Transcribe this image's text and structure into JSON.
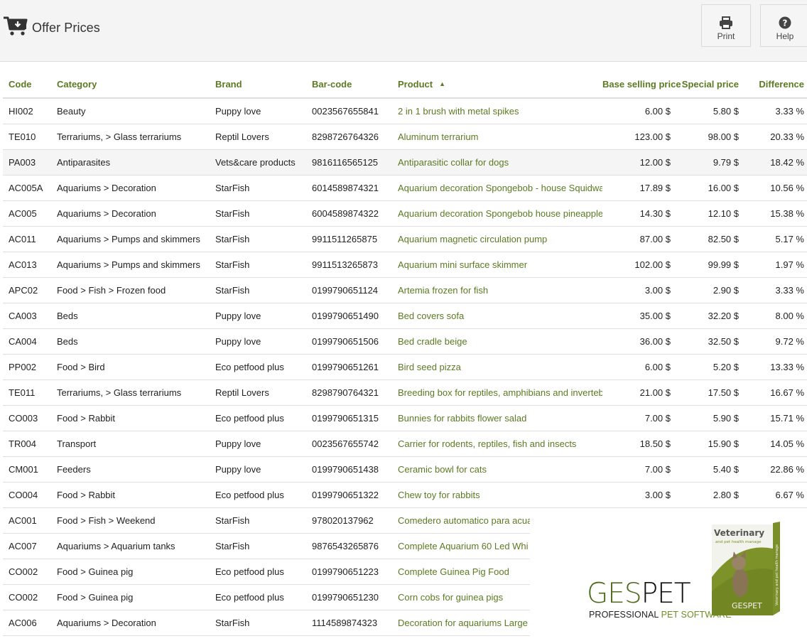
{
  "header": {
    "title": "Offer Prices",
    "icon": "cart-download-icon",
    "buttons": [
      {
        "label": "Print",
        "icon": "print-icon"
      },
      {
        "label": "Help",
        "icon": "help-circle-icon"
      }
    ]
  },
  "table": {
    "columns": [
      "Code",
      "Category",
      "Brand",
      "Bar-code",
      "Product",
      "Base selling price",
      "Special price",
      "Difference"
    ],
    "sort": {
      "column": "Product",
      "direction": "ascending",
      "icon": "sort-up-icon"
    },
    "rows": [
      {
        "code": "HI002",
        "category": "Beauty",
        "brand": "Puppy love",
        "barcode": "0023567655841",
        "product": "2 in 1 brush with metal spikes",
        "base": "6.00 $",
        "special": "5.80 $",
        "diff": "3.33 %"
      },
      {
        "code": "TE010",
        "category": "Terrariums, > Glass terrariums",
        "brand": "Reptil Lovers",
        "barcode": "8298726764326",
        "product": "Aluminum terrarium",
        "base": "123.00 $",
        "special": "98.00 $",
        "diff": "20.33 %"
      },
      {
        "code": "PA003",
        "category": "Antiparasites",
        "brand": "Vets&care products",
        "barcode": "9816116565125",
        "product": "Antiparasitic collar for dogs",
        "base": "12.00 $",
        "special": "9.79 $",
        "diff": "18.42 %",
        "highlighted": true
      },
      {
        "code": "AC005A",
        "category": "Aquariums > Decoration",
        "brand": "StarFish",
        "barcode": "6014589874321",
        "product": "Aquarium decoration Spongebob - house Squidward",
        "base": "17.89 $",
        "special": "16.00 $",
        "diff": "10.56 %"
      },
      {
        "code": "AC005",
        "category": "Aquariums > Decoration",
        "brand": "StarFish",
        "barcode": "6004589874322",
        "product": "Aquarium decoration Spongebob house pineapple",
        "base": "14.30 $",
        "special": "12.10 $",
        "diff": "15.38 %"
      },
      {
        "code": "AC011",
        "category": "Aquariums > Pumps and skimmers",
        "brand": "StarFish",
        "barcode": "9911511265875",
        "product": "Aquarium magnetic circulation pump",
        "base": "87.00 $",
        "special": "82.50 $",
        "diff": "5.17 %"
      },
      {
        "code": "AC013",
        "category": "Aquariums > Pumps and skimmers",
        "brand": "StarFish",
        "barcode": "9911513265873",
        "product": "Aquarium mini surface skimmer",
        "base": "102.00 $",
        "special": "99.99 $",
        "diff": "1.97 %"
      },
      {
        "code": "APC02",
        "category": "Food > Fish > Frozen food",
        "brand": "StarFish",
        "barcode": "0199790651124",
        "product": "Artemia frozen for fish",
        "base": "3.00 $",
        "special": "2.90 $",
        "diff": "3.33 %"
      },
      {
        "code": "CA003",
        "category": "Beds",
        "brand": "Puppy love",
        "barcode": "0199790651490",
        "product": "Bed covers sofa",
        "base": "35.00 $",
        "special": "32.20 $",
        "diff": "8.00 %"
      },
      {
        "code": "CA004",
        "category": "Beds",
        "brand": "Puppy love",
        "barcode": "0199790651506",
        "product": "Bed cradle beige",
        "base": "36.00 $",
        "special": "32.50 $",
        "diff": "9.72 %"
      },
      {
        "code": "PP002",
        "category": "Food > Bird",
        "brand": "Eco petfood plus",
        "barcode": "0199790651261",
        "product": "Bird seed pizza",
        "base": "6.00 $",
        "special": "5.20 $",
        "diff": "13.33 %"
      },
      {
        "code": "TE011",
        "category": "Terrariums, > Glass terrariums",
        "brand": "Reptil Lovers",
        "barcode": "8298790764321",
        "product": "Breeding box for reptiles, amphibians and invertebrates",
        "base": "21.00 $",
        "special": "17.50 $",
        "diff": "16.67 %"
      },
      {
        "code": "CO003",
        "category": "Food > Rabbit",
        "brand": "Eco petfood plus",
        "barcode": "0199790651315",
        "product": "Bunnies for rabbits flower salad",
        "base": "7.00 $",
        "special": "5.90 $",
        "diff": "15.71 %"
      },
      {
        "code": "TR004",
        "category": "Transport",
        "brand": "Puppy love",
        "barcode": "0023567655742",
        "product": "Carrier for rodents, reptiles, fish and insects",
        "base": "18.50 $",
        "special": "15.90 $",
        "diff": "14.05 %"
      },
      {
        "code": "CM001",
        "category": "Feeders",
        "brand": "Puppy love",
        "barcode": "0199790651438",
        "product": "Ceramic bowl for cats",
        "base": "7.00 $",
        "special": "5.40 $",
        "diff": "22.86 %"
      },
      {
        "code": "CO004",
        "category": "Food > Rabbit",
        "brand": "Eco petfood plus",
        "barcode": "0199790651322",
        "product": "Chew toy for rabbits",
        "base": "3.00 $",
        "special": "2.80 $",
        "diff": "6.67 %"
      },
      {
        "code": "AC001",
        "category": "Food > Fish > Weekend",
        "brand": "StarFish",
        "barcode": "978020137962",
        "product": "Comedero automatico para acua",
        "base": "",
        "special": "",
        "diff": ""
      },
      {
        "code": "AC007",
        "category": "Aquariums > Aquarium tanks",
        "brand": "StarFish",
        "barcode": "9876543265876",
        "product": "Complete Aquarium 60 Led Whi",
        "base": "",
        "special": "",
        "diff": ""
      },
      {
        "code": "CO002",
        "category": "Food > Guinea pig",
        "brand": "Eco petfood plus",
        "barcode": "0199790651223",
        "product": "Complete Guinea Pig Food",
        "base": "",
        "special": "",
        "diff": ""
      },
      {
        "code": "CO002",
        "category": "Food > Guinea pig",
        "brand": "Eco petfood plus",
        "barcode": "0199790651230",
        "product": "Corn cobs for guinea pigs",
        "base": "",
        "special": "",
        "diff": ""
      },
      {
        "code": "AC006",
        "category": "Aquariums > Decoration",
        "brand": "StarFish",
        "barcode": "1114589874323",
        "product": "Decoration for aquariums Large",
        "base": "",
        "special": "",
        "diff": ""
      }
    ]
  },
  "logo": {
    "ges": "GES",
    "pet": "PET",
    "tagline_a": "PROFESSIONAL ",
    "tagline_b": "PET SOFTWARE",
    "box_title": "Veterinary",
    "box_subtitle": "and pet health manage",
    "box_brand": "GESPET",
    "box_side": "Veterinary and pet health manage"
  },
  "colors": {
    "accent": "#5b7a22",
    "header_bg": "#f4f4f4",
    "row_highlight": "#f5f5f5"
  }
}
